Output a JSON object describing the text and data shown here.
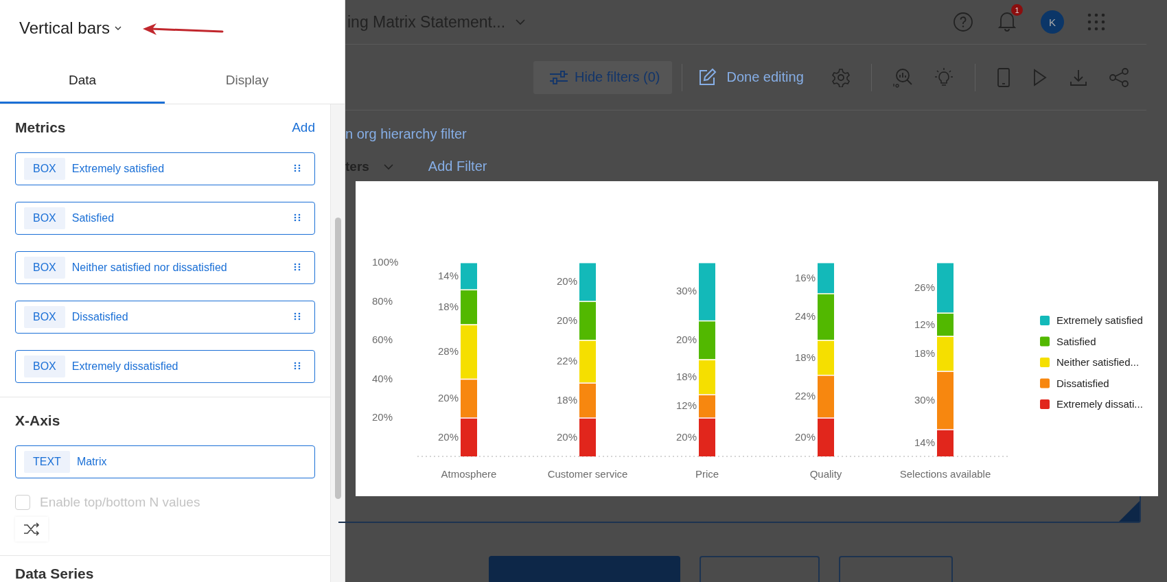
{
  "panel": {
    "chart_type": "Vertical bars",
    "tabs": [
      {
        "label": "Data",
        "selected": true
      },
      {
        "label": "Display",
        "selected": false
      }
    ],
    "metrics": {
      "title": "Metrics",
      "add_link": "Add",
      "items": [
        {
          "tag": "BOX",
          "label": "Extremely satisfied"
        },
        {
          "tag": "BOX",
          "label": "Satisfied"
        },
        {
          "tag": "BOX",
          "label": "Neither satisfied nor dissatisfied"
        },
        {
          "tag": "BOX",
          "label": "Dissatisfied"
        },
        {
          "tag": "BOX",
          "label": "Extremely dissatisfied"
        }
      ]
    },
    "x_axis": {
      "title": "X-Axis",
      "items": [
        {
          "tag": "TEXT",
          "label": "Matrix"
        }
      ],
      "top_n": {
        "label": "Enable top/bottom N values",
        "checked": false,
        "disabled": true
      }
    },
    "next_section": "Data Series"
  },
  "header": {
    "title": "ing Matrix Statement...",
    "notification_count": "1",
    "avatar": "K"
  },
  "toolbar": {
    "hide_filters": "Hide filters (0)",
    "done_editing": "Done editing"
  },
  "filters": {
    "org_filter_link": "n org hierarchy filter",
    "filters_dropdown": "ters",
    "add_filter": "Add Filter"
  },
  "chart": {
    "chart_data": {
      "type": "bar",
      "stacked": true,
      "legend": "right",
      "value_labels": [
        [
          "14%",
          "20%",
          "30%",
          "16%",
          "26%"
        ],
        [
          "18%",
          "20%",
          "20%",
          "24%",
          "12%"
        ],
        [
          "28%",
          "22%",
          "18%",
          "18%",
          "18%"
        ],
        [
          "20%",
          "18%",
          "12%",
          "22%",
          "30%"
        ],
        [
          "20%",
          "20%",
          "20%",
          "20%",
          "14%"
        ]
      ],
      "categories": [
        "Atmosphere",
        "Customer service",
        "Price",
        "Quality",
        "Selections available"
      ],
      "ylim": [
        0,
        100
      ],
      "yticks": [
        {
          "value": 20,
          "label": "20%"
        },
        {
          "value": 40,
          "label": "40%"
        },
        {
          "value": 60,
          "label": "60%"
        },
        {
          "value": 80,
          "label": "80%"
        },
        {
          "value": 100,
          "label": "100%"
        }
      ],
      "series": [
        {
          "name": "Extremely satisfied",
          "color": "#13b9b9",
          "values": [
            14,
            20,
            30,
            16,
            26
          ]
        },
        {
          "name": "Satisfied",
          "color": "#52b800",
          "values": [
            18,
            20,
            20,
            24,
            12
          ]
        },
        {
          "name": "Neither satisfied...",
          "color": "#f5df00",
          "values": [
            28,
            22,
            18,
            18,
            18
          ]
        },
        {
          "name": "Dissatisfied",
          "color": "#f7870f",
          "values": [
            20,
            18,
            12,
            22,
            30
          ]
        },
        {
          "name": "Extremely dissati...",
          "color": "#e1261c",
          "values": [
            20,
            20,
            20,
            20,
            14
          ]
        }
      ]
    }
  }
}
